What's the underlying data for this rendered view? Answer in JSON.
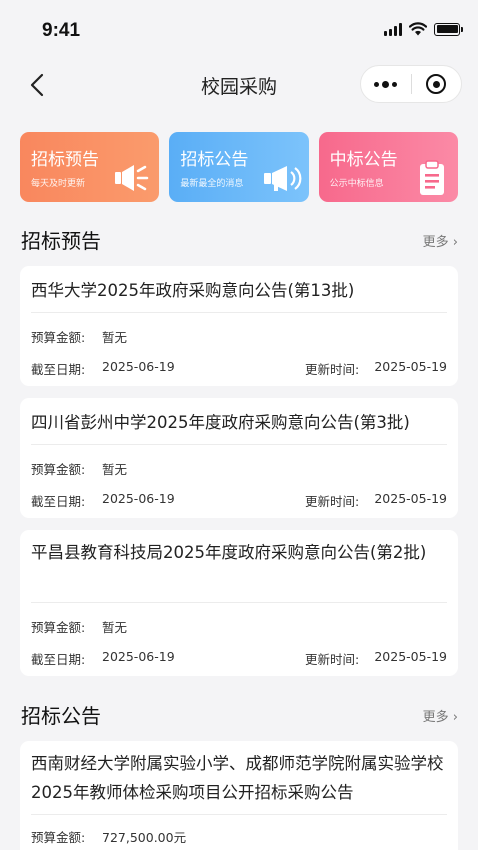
{
  "status": {
    "time": "9:41"
  },
  "nav": {
    "title": "校园采购"
  },
  "categories": [
    {
      "title": "招标预告",
      "subtitle": "每天及时更新"
    },
    {
      "title": "招标公告",
      "subtitle": "最新最全的消息"
    },
    {
      "title": "中标公告",
      "subtitle": "公示中标信息"
    }
  ],
  "sections": [
    {
      "title": "招标预告",
      "more": "更多 ›",
      "items": [
        {
          "title": "西华大学2025年政府采购意向公告(第13批)",
          "budget_label": "预算金额:",
          "budget": "暂无",
          "deadline_label": "截至日期:",
          "deadline": "2025-06-19",
          "updated_label": "更新时间:",
          "updated": "2025-05-19"
        },
        {
          "title": "四川省彭州中学2025年度政府采购意向公告(第3批)",
          "budget_label": "预算金额:",
          "budget": "暂无",
          "deadline_label": "截至日期:",
          "deadline": "2025-06-19",
          "updated_label": "更新时间:",
          "updated": "2025-05-19"
        },
        {
          "title": "平昌县教育科技局2025年度政府采购意向公告(第2批)",
          "budget_label": "预算金额:",
          "budget": "暂无",
          "deadline_label": "截至日期:",
          "deadline": "2025-06-19",
          "updated_label": "更新时间:",
          "updated": "2025-05-19"
        }
      ]
    },
    {
      "title": "招标公告",
      "more": "更多 ›",
      "items": [
        {
          "title": "西南财经大学附属实验小学、成都师范学院附属实验学校2025年教师体检采购项目公开招标采购公告",
          "budget_label": "预算金额:",
          "budget": "727,500.00元"
        }
      ]
    }
  ]
}
